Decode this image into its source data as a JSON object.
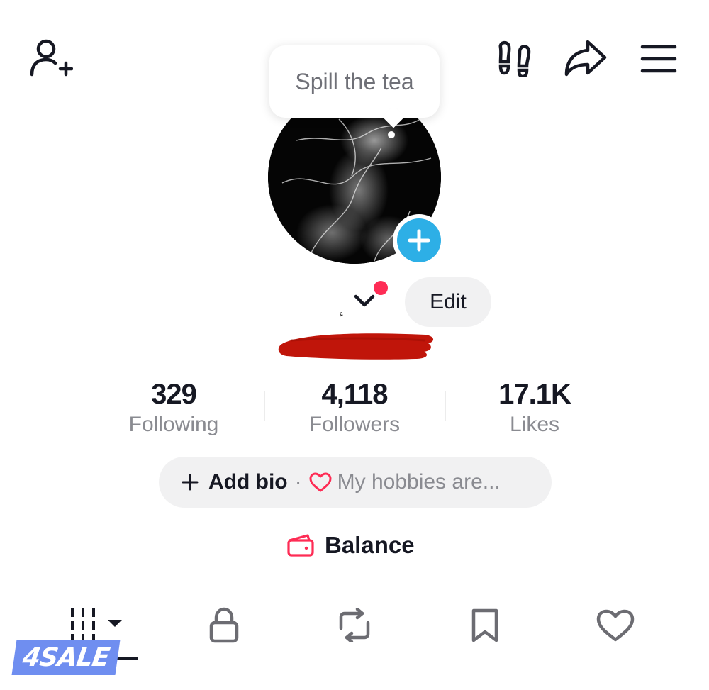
{
  "tooltip": {
    "text": "Spill the tea"
  },
  "profile": {
    "username_mark": "ء",
    "edit_label": "Edit"
  },
  "stats": [
    {
      "value": "329",
      "label": "Following"
    },
    {
      "value": "4,118",
      "label": "Followers"
    },
    {
      "value": "17.1K",
      "label": "Likes"
    }
  ],
  "bio": {
    "add_label": "Add bio",
    "separator": "·",
    "hint": "My hobbies are..."
  },
  "balance": {
    "label": "Balance"
  },
  "tabs": [
    "videos",
    "private",
    "reposts",
    "favorites",
    "liked"
  ],
  "watermark": "4SALE",
  "icons": {
    "top_left": "add-friend-icon",
    "top_right": [
      "footprints-icon",
      "share-icon",
      "menu-icon"
    ]
  },
  "colors": {
    "accent_red": "#fe2c55",
    "avatar_plus_blue": "#2dafe6",
    "redaction": "#c0150a"
  }
}
